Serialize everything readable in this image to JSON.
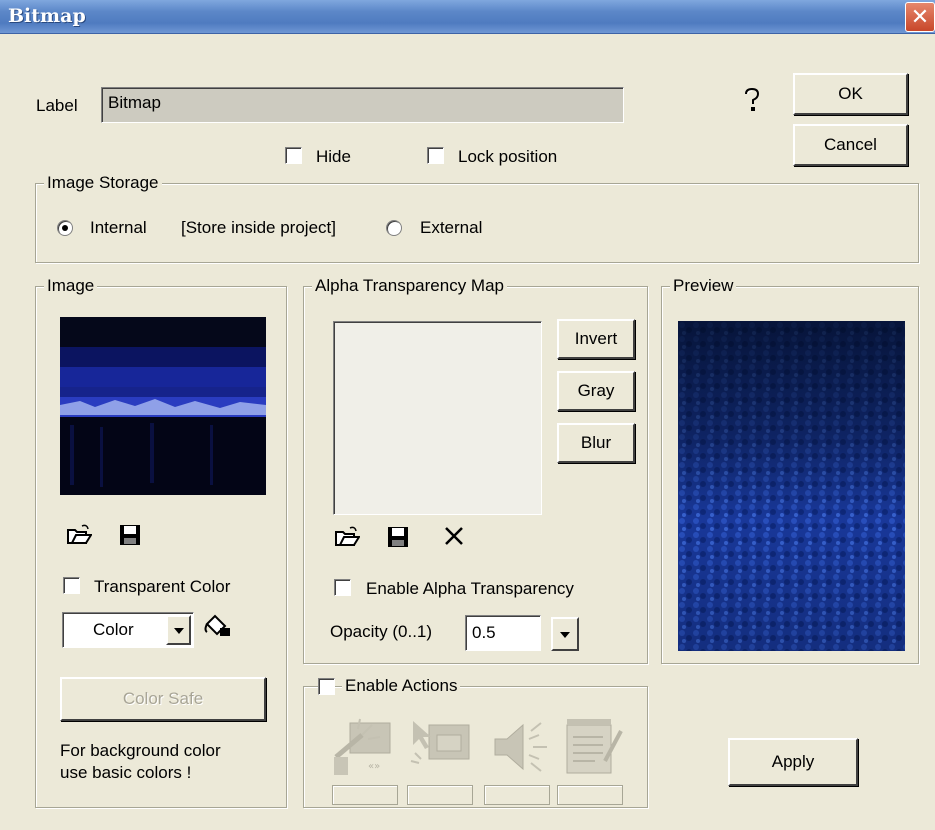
{
  "window": {
    "title": "Bitmap",
    "close_label": "✕"
  },
  "header": {
    "label_caption": "Label",
    "label_value": "Bitmap",
    "help_icon": "question-mark-icon",
    "ok_label": "OK",
    "cancel_label": "Cancel"
  },
  "options": {
    "hide_label": "Hide",
    "lock_label": "Lock position"
  },
  "storage": {
    "legend": "Image Storage",
    "internal_label": "Internal",
    "internal_hint": "[Store inside project]",
    "external_label": "External",
    "selected": "Internal"
  },
  "image_group": {
    "legend": "Image",
    "transparent_label": "Transparent Color",
    "color_value": "Color",
    "color_safe_label": "Color Safe",
    "note_line1": "For background color",
    "note_line2": "use basic colors !"
  },
  "alpha_group": {
    "legend": "Alpha Transparency Map",
    "invert_label": "Invert",
    "gray_label": "Gray",
    "blur_label": "Blur",
    "enable_label": "Enable Alpha Transparency",
    "opacity_label": "Opacity (0..1)",
    "opacity_value": "0.5"
  },
  "preview_group": {
    "legend": "Preview"
  },
  "actions_group": {
    "legend": "Enable Actions",
    "icons": [
      "wand-action-icon",
      "mouse-action-icon",
      "sound-action-icon",
      "notepad-action-icon"
    ]
  },
  "apply_label": "Apply",
  "colors": {
    "title_bar": "#5c87c8",
    "dialog_bg": "#ece9d8",
    "preview_blue": "#1a3a9c"
  }
}
